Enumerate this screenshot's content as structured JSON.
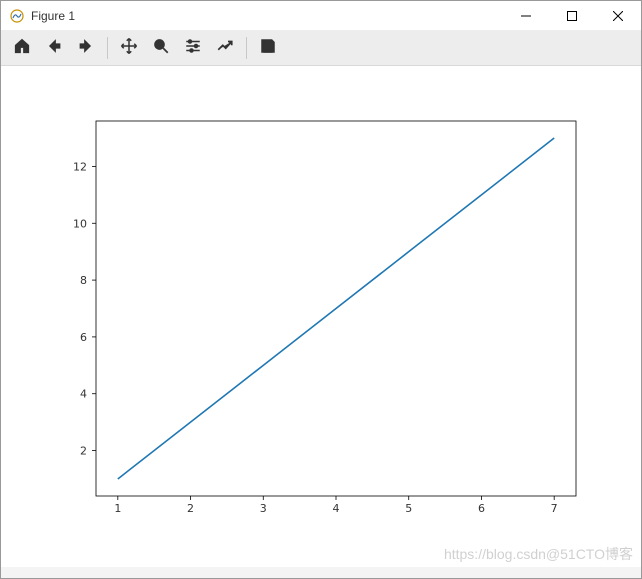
{
  "window": {
    "title": "Figure 1"
  },
  "toolbar": {
    "home": "Home",
    "back": "Back",
    "forward": "Forward",
    "pan": "Pan",
    "zoom": "Zoom",
    "configure": "Configure subplots",
    "edit": "Edit axis",
    "save": "Save"
  },
  "watermark": "https://blog.csdn@51CTO博客",
  "chart_data": {
    "type": "line",
    "x": [
      1,
      2,
      3,
      4,
      5,
      6,
      7
    ],
    "y": [
      1,
      3,
      5,
      7,
      9,
      11,
      13
    ],
    "xlim": [
      0.7,
      7.3
    ],
    "ylim": [
      0.4,
      13.6
    ],
    "xticks": [
      1,
      2,
      3,
      4,
      5,
      6,
      7
    ],
    "yticks": [
      2,
      4,
      6,
      8,
      10,
      12
    ],
    "title": "",
    "xlabel": "",
    "ylabel": ""
  }
}
